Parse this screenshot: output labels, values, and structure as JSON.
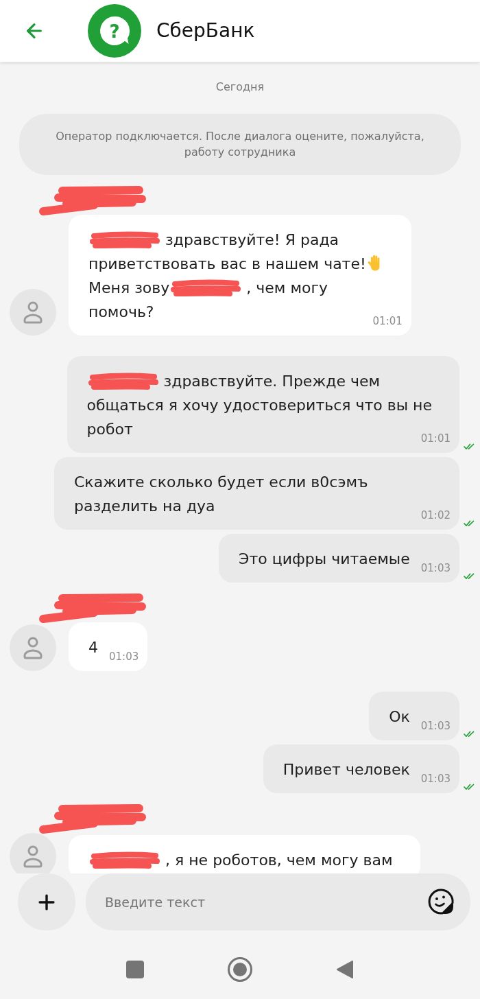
{
  "header": {
    "title": "СберБанк",
    "logo_mark": "?"
  },
  "chat": {
    "date": "Сегодня",
    "notice": "Оператор подключается. После диалога оцените, пожалуйста, работу сотрудника",
    "messages": [
      {
        "kind": "incoming",
        "sender_hidden": true,
        "parts": [
          {
            "kind": "redacted"
          },
          {
            "kind": "text",
            "text": "здравствуйте! Я рада"
          },
          {
            "kind": "break"
          },
          {
            "kind": "text",
            "text": "приветствовать вас в нашем чате!"
          },
          {
            "kind": "emoji"
          },
          {
            "kind": "break"
          },
          {
            "kind": "text",
            "text": "Меня зову"
          },
          {
            "kind": "redacted"
          },
          {
            "kind": "text",
            "text": ", чем могу"
          },
          {
            "kind": "break"
          },
          {
            "kind": "text",
            "text": "помочь?"
          }
        ],
        "time": "01:01"
      },
      {
        "kind": "outgoing",
        "read": true,
        "parts": [
          {
            "kind": "redacted"
          },
          {
            "kind": "text",
            "text": "здравствуйте. Прежде чем"
          },
          {
            "kind": "break"
          },
          {
            "kind": "text",
            "text": "общаться я хочу удостовериться что вы не"
          },
          {
            "kind": "break"
          },
          {
            "kind": "text",
            "text": "робот"
          }
        ],
        "time": "01:01"
      },
      {
        "kind": "outgoing",
        "read": true,
        "parts": [
          {
            "kind": "text",
            "text": "Скажите сколько будет если в0сэмъ разделить на дуа"
          }
        ],
        "time": "01:02"
      },
      {
        "kind": "outgoing",
        "read": true,
        "parts": [
          {
            "kind": "text",
            "text": "Это цифры читаемые"
          }
        ],
        "time": "01:03"
      },
      {
        "kind": "incoming",
        "sender_hidden": true,
        "parts": [
          {
            "kind": "text",
            "text": "4"
          }
        ],
        "time": "01:03"
      },
      {
        "kind": "outgoing",
        "read": true,
        "parts": [
          {
            "kind": "text",
            "text": "Ок"
          }
        ],
        "time": "01:03"
      },
      {
        "kind": "outgoing",
        "read": true,
        "parts": [
          {
            "kind": "text",
            "text": "Привет человек"
          }
        ],
        "time": "01:03"
      },
      {
        "kind": "incoming",
        "sender_hidden": true,
        "parts": [
          {
            "kind": "redacted"
          },
          {
            "kind": "text",
            "text": ", я не роботов, чем могу вам"
          }
        ]
      }
    ]
  },
  "composer": {
    "placeholder": "Введите текст"
  }
}
